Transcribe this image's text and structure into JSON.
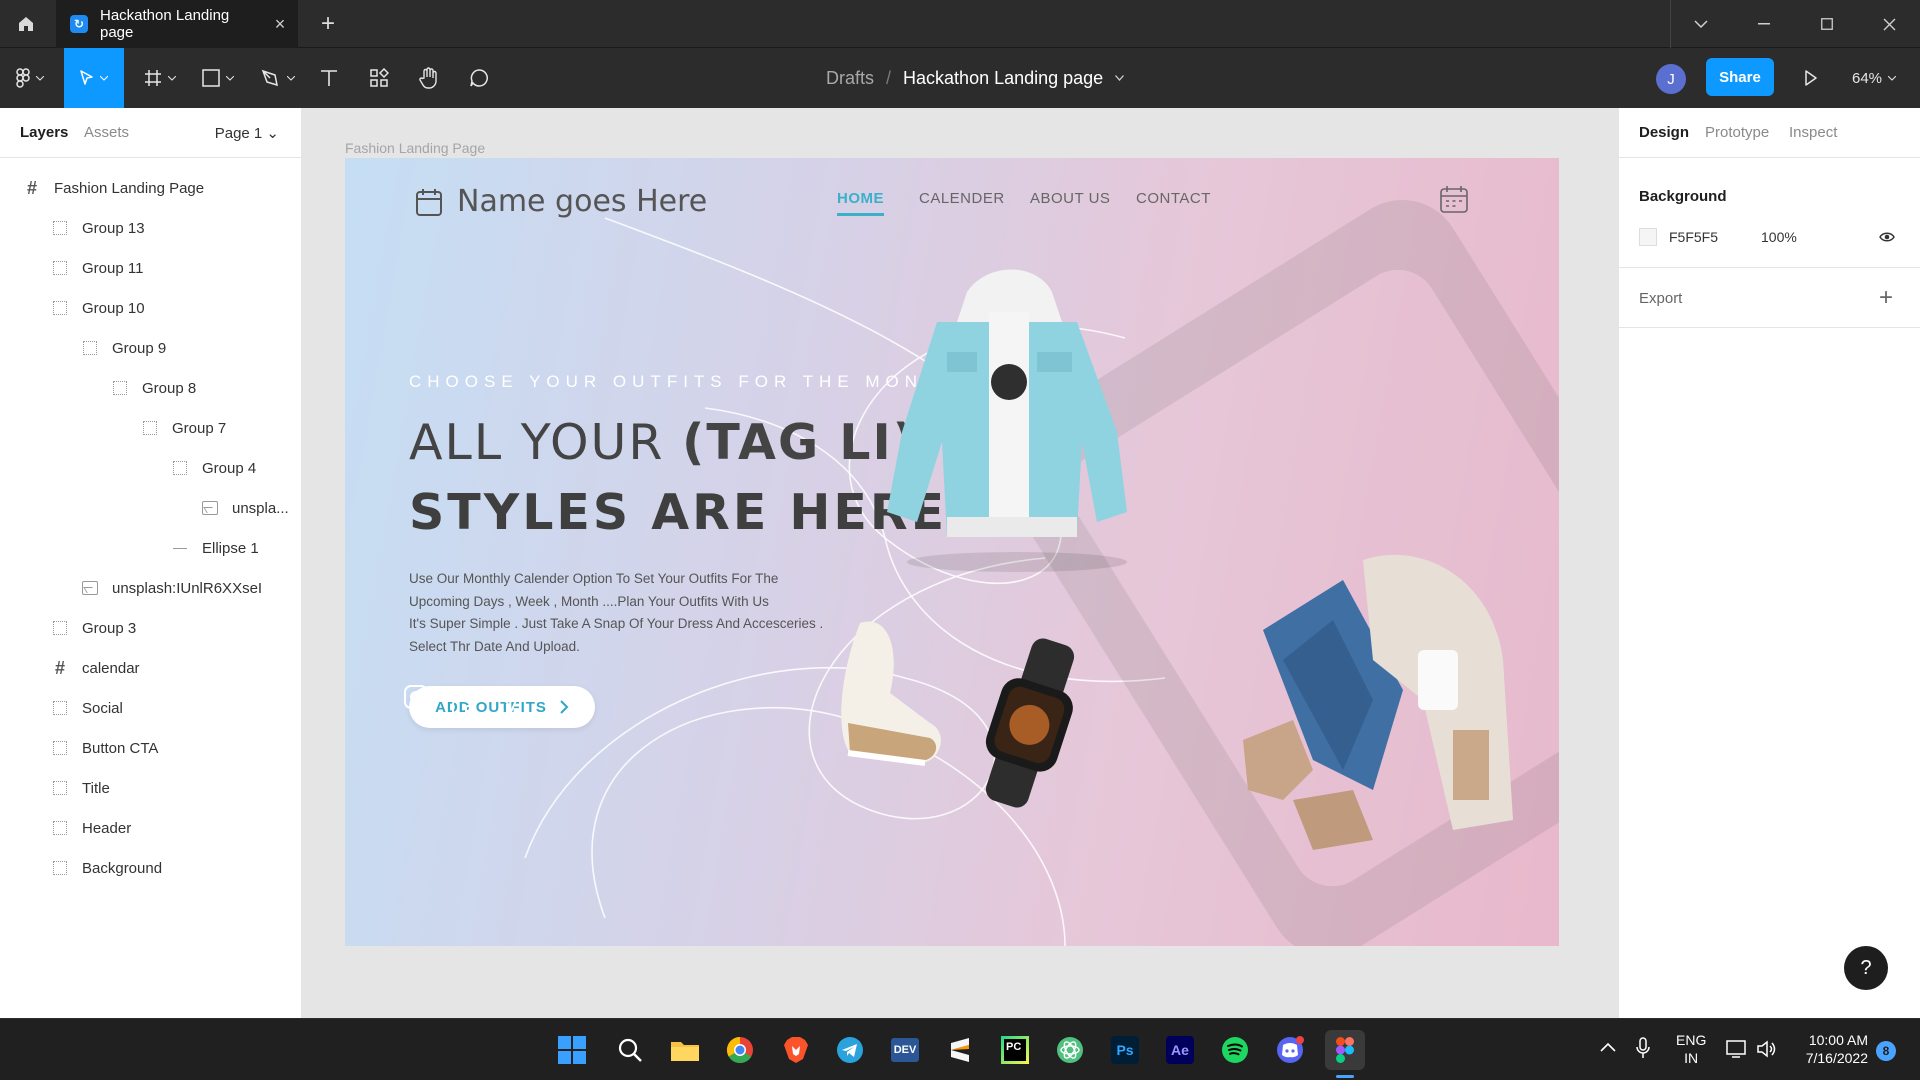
{
  "tab": {
    "title": "Hackathon Landing page"
  },
  "toolbar": {
    "breadcrumb_parent": "Drafts",
    "breadcrumb_sep": "/",
    "file_name": "Hackathon Landing page",
    "avatar_initial": "J",
    "share_label": "Share",
    "zoom": "64%"
  },
  "left_panel": {
    "tabs": [
      "Layers",
      "Assets"
    ],
    "page_select": "Page 1 ⌄",
    "layers": [
      {
        "name": "Fashion Landing Page",
        "type": "frame",
        "indent": 0
      },
      {
        "name": "Group 13",
        "type": "group",
        "indent": 1
      },
      {
        "name": "Group 11",
        "type": "group",
        "indent": 1
      },
      {
        "name": "Group 10",
        "type": "group",
        "indent": 1
      },
      {
        "name": "Group 9",
        "type": "group",
        "indent": 2
      },
      {
        "name": "Group 8",
        "type": "group",
        "indent": 3
      },
      {
        "name": "Group 7",
        "type": "group",
        "indent": 4
      },
      {
        "name": "Group 4",
        "type": "group",
        "indent": 5
      },
      {
        "name": "unspla...",
        "type": "image",
        "indent": 6
      },
      {
        "name": "Ellipse 1",
        "type": "line",
        "indent": 5
      },
      {
        "name": "unsplash:IUnlR6XXseI",
        "type": "image",
        "indent": 2
      },
      {
        "name": "Group 3",
        "type": "group",
        "indent": 1
      },
      {
        "name": "calendar",
        "type": "frame",
        "indent": 1
      },
      {
        "name": "Social",
        "type": "group",
        "indent": 1
      },
      {
        "name": "Button CTA",
        "type": "group",
        "indent": 1
      },
      {
        "name": "Title",
        "type": "group",
        "indent": 1
      },
      {
        "name": "Header",
        "type": "group",
        "indent": 1
      },
      {
        "name": "Background",
        "type": "group",
        "indent": 1
      }
    ]
  },
  "canvas": {
    "frame_label": "Fashion Landing Page",
    "site": {
      "title": "Name goes Here",
      "nav": [
        "HOME",
        "CALENDER",
        "ABOUT US",
        "CONTACT"
      ],
      "subheading": "CHOOSE YOUR OUTFITS FOR THE MONTH",
      "headline_1_light": "ALL YOUR ",
      "headline_1_bold": "(TAG LI)",
      "headline_2": "STYLES ARE HERE",
      "body_lines": [
        "Use Our Monthly Calender Option To Set Your Outfits For The",
        "Upcoming Days , Week , Month ....Plan Your Outfits With Us",
        "It's Super Simple . Just Take A Snap Of Your Dress And Accesceries .",
        "Select Thr Date And Upload."
      ],
      "cta_label": "ADD OUTFITS",
      "watermark_months": [
        "Jan",
        "Feb",
        "Mar"
      ]
    }
  },
  "right_panel": {
    "tabs": [
      "Design",
      "Prototype",
      "Inspect"
    ],
    "background_title": "Background",
    "bg_hex": "F5F5F5",
    "bg_opacity": "100%",
    "export_title": "Export"
  },
  "help_label": "?",
  "taskbar": {
    "language": "ENG",
    "region": "IN",
    "time": "10:00 AM",
    "date": "7/16/2022",
    "notification_count": "8",
    "apps": [
      "start",
      "search",
      "file-explorer",
      "chrome",
      "brave",
      "telegram",
      "dev",
      "sublime",
      "pycharm",
      "atom",
      "Ps",
      "Ae",
      "spotify",
      "discord",
      "figma"
    ]
  },
  "colors": {
    "figma_blue": "#0d99ff",
    "nav_active": "#3bb0c9",
    "canvas_bg": "#e5e5e5"
  }
}
